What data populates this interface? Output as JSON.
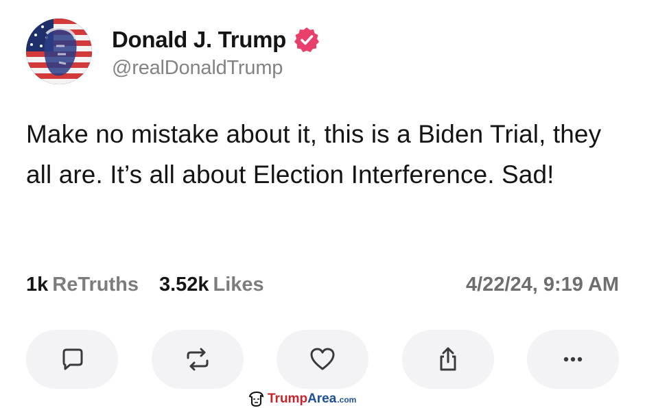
{
  "post": {
    "author": {
      "display_name": "Donald J. Trump",
      "handle": "@realDonaldTrump",
      "verified_icon": "verified-badge-icon",
      "badge_color": "#e8406a"
    },
    "text": "Make no mistake about it, this is a Biden Trial, they all are. It’s all about Election Interference. Sad!",
    "stats": {
      "retruths_count": "1k",
      "retruths_label": "ReTruths",
      "likes_count": "3.52k",
      "likes_label": "Likes"
    },
    "timestamp": "4/22/24, 9:19 AM"
  },
  "actions": [
    {
      "name": "reply",
      "icon": "comment-icon"
    },
    {
      "name": "retruth",
      "icon": "repost-icon"
    },
    {
      "name": "like",
      "icon": "heart-icon"
    },
    {
      "name": "share",
      "icon": "share-icon"
    },
    {
      "name": "more",
      "icon": "more-dots-icon"
    }
  ],
  "watermark": {
    "part1": "Trump",
    "part2": "Area",
    "part3": ".com",
    "logo_icon": "trump-face-logo-icon",
    "colors": {
      "red": "#c8222a",
      "blue": "#1d4f9c"
    }
  }
}
